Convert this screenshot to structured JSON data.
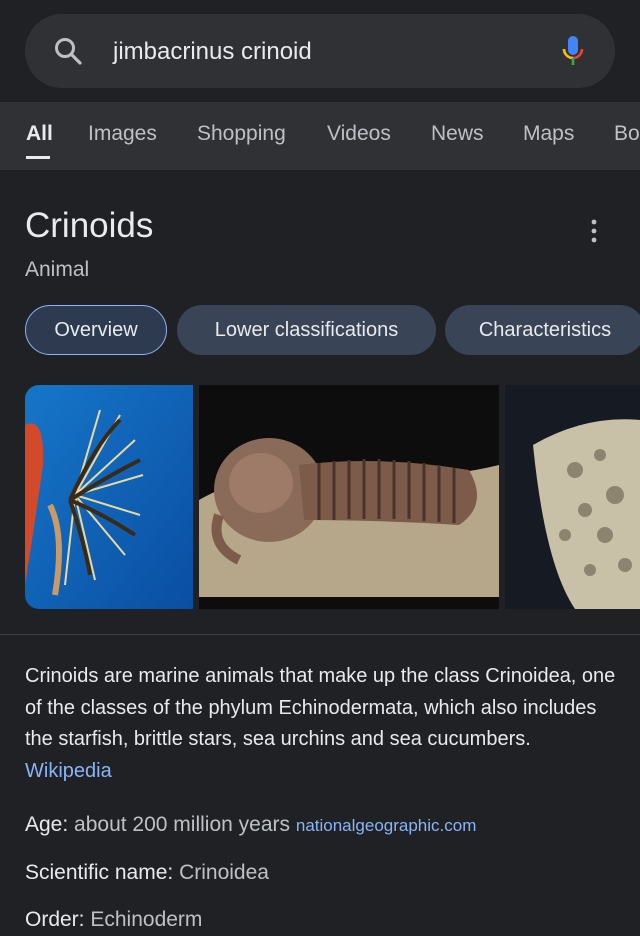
{
  "search": {
    "query": "jimbacrinus crinoid"
  },
  "tabs": [
    {
      "label": "All"
    },
    {
      "label": "Images"
    },
    {
      "label": "Shopping"
    },
    {
      "label": "Videos"
    },
    {
      "label": "News"
    },
    {
      "label": "Maps"
    },
    {
      "label": "Bo"
    }
  ],
  "knowledge": {
    "title": "Crinoids",
    "subtitle": "Animal",
    "chips": [
      {
        "label": "Overview"
      },
      {
        "label": "Lower classifications"
      },
      {
        "label": "Characteristics"
      }
    ],
    "description": "Crinoids are marine animals that make up the class Crinoidea, one of the classes of the phylum Echinodermata, which also includes the starfish, brittle stars, sea urchins and sea cucumbers.",
    "description_source": "Wikipedia",
    "facts": [
      {
        "label": "Age:",
        "value": "about 200 million years",
        "source": "nationalgeographic.com"
      },
      {
        "label": "Scientific name:",
        "value": "Crinoidea"
      },
      {
        "label": "Order:",
        "value": "Echinoderm"
      }
    ]
  },
  "colors": {
    "background": "#202124",
    "surface": "#303134",
    "accent": "#8ab4f8",
    "chip": "#394457"
  },
  "icons": [
    "search-icon",
    "mic-icon",
    "more-vert-icon"
  ]
}
